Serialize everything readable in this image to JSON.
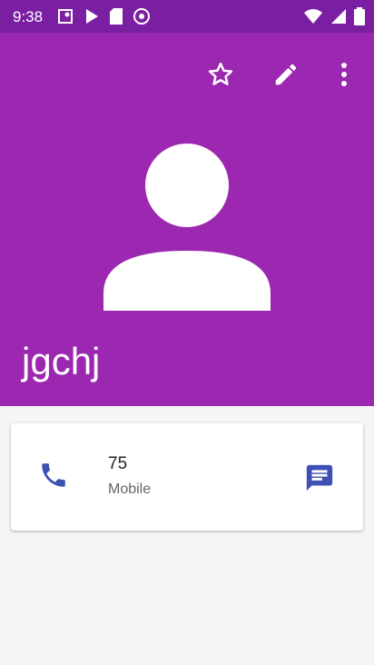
{
  "status_bar": {
    "time": "9:38"
  },
  "contact": {
    "name": "jgchj",
    "phone": {
      "number": "75",
      "type": "Mobile"
    }
  },
  "colors": {
    "header": "#9c27b0",
    "status_bar": "#7b1fa2",
    "icon": "#3f51b5"
  },
  "icons": [
    "star-icon",
    "edit-icon",
    "more-icon",
    "avatar-icon",
    "phone-icon",
    "message-icon"
  ]
}
